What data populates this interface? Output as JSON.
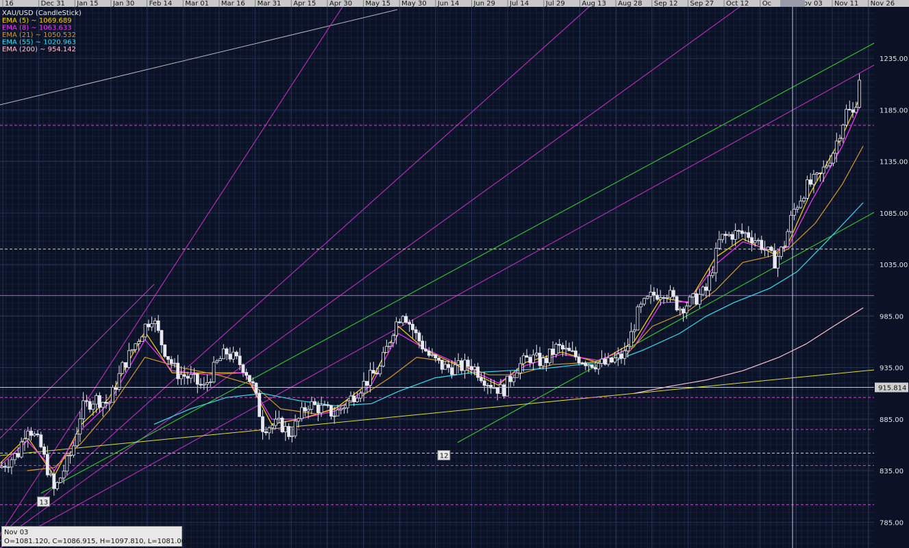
{
  "chart_data": {
    "type": "candlestick",
    "title": "XAU/USD (CandleStick)",
    "x_axis_labels": [
      "16",
      "Dec 31",
      "Jan 15",
      "Jan 30",
      "Feb 14",
      "Mar 01",
      "Mar 16",
      "Mar 31",
      "Apr 15",
      "Apr 30",
      "May 15",
      "May 30",
      "Jun 14",
      "Jun 29",
      "Jul 14",
      "Jul 29",
      "Aug 13",
      "Aug 28",
      "Sep 12",
      "Sep 27",
      "Oct 12",
      "Oc",
      "Nov 03",
      "Nov 11",
      "Nov 26"
    ],
    "y_axis_labels": [
      "1235.00",
      "1185.00",
      "1135.00",
      "1085.00",
      "1035.00",
      "985.00",
      "935.00",
      "915.814",
      "885.00",
      "835.00",
      "785.00"
    ],
    "ylim": [
      760,
      1285
    ],
    "current_price": "915.814",
    "legend": [
      {
        "label": "EMA (5) ~ 1069.689",
        "color": "#ffd200"
      },
      {
        "label": "EMA (8) ~ 1063.633",
        "color": "#ff33ff"
      },
      {
        "label": "EMA (21) ~ 1050.532",
        "color": "#d79a2b"
      },
      {
        "label": "EMA (55) ~ 1020.963",
        "color": "#35e0f0"
      },
      {
        "label": "EMA (200) ~ 954.142",
        "color": "#ffc2d0"
      }
    ],
    "horizontal_levels": [
      {
        "value": 1170,
        "color": "#d24ad2",
        "style": "dashed"
      },
      {
        "value": 1050,
        "color": "#e0e030",
        "style": "dashed"
      },
      {
        "value": 1005,
        "color": "#d24ad2",
        "style": "solid"
      },
      {
        "value": 906,
        "color": "#d24ad2",
        "style": "dashed"
      },
      {
        "value": 875,
        "color": "#d24ad2",
        "style": "dashed"
      },
      {
        "value": 852,
        "color": "#e0e030",
        "style": "dashed"
      },
      {
        "value": 840,
        "color": "#d24ad2",
        "style": "dashed"
      },
      {
        "value": 802,
        "color": "#d24ad2",
        "style": "dashed"
      }
    ],
    "markers": [
      {
        "label": "13",
        "x": 4.8,
        "value": 805
      },
      {
        "label": "12",
        "x": 49,
        "value": 850
      }
    ],
    "crosshair": {
      "x": 87.5,
      "price": 915.814
    },
    "price_path": [
      [
        0,
        838
      ],
      [
        2,
        852
      ],
      [
        3,
        880
      ],
      [
        4.5,
        858
      ],
      [
        6,
        815
      ],
      [
        7,
        835
      ],
      [
        8,
        855
      ],
      [
        9,
        895
      ],
      [
        10.5,
        905
      ],
      [
        12,
        900
      ],
      [
        13.5,
        935
      ],
      [
        16,
        975
      ],
      [
        16.8,
        985
      ],
      [
        18,
        955
      ],
      [
        19.5,
        930
      ],
      [
        21,
        925
      ],
      [
        22.5,
        915
      ],
      [
        24,
        940
      ],
      [
        25,
        950
      ],
      [
        27,
        935
      ],
      [
        28,
        915
      ],
      [
        29,
        878
      ],
      [
        31,
        880
      ],
      [
        32,
        870
      ],
      [
        34,
        900
      ],
      [
        35.5,
        895
      ],
      [
        37,
        890
      ],
      [
        38.5,
        903
      ],
      [
        40,
        918
      ],
      [
        42,
        935
      ],
      [
        43.5,
        975
      ],
      [
        44.5,
        990
      ],
      [
        46,
        965
      ],
      [
        47.5,
        945
      ],
      [
        49,
        935
      ],
      [
        50.5,
        935
      ],
      [
        52,
        938
      ],
      [
        54,
        920
      ],
      [
        55.5,
        912
      ],
      [
        57,
        935
      ],
      [
        58.5,
        945
      ],
      [
        60,
        940
      ],
      [
        61.5,
        955
      ],
      [
        63,
        948
      ],
      [
        65,
        940
      ],
      [
        67,
        938
      ],
      [
        69,
        948
      ],
      [
        70.5,
        990
      ],
      [
        72,
        1005
      ],
      [
        73.5,
        1010
      ],
      [
        75,
        993
      ],
      [
        76.5,
        1000
      ],
      [
        78,
        1010
      ],
      [
        79.5,
        1060
      ],
      [
        81,
        1065
      ],
      [
        82.5,
        1065
      ],
      [
        84,
        1055
      ],
      [
        85.5,
        1038
      ],
      [
        86.5,
        1052
      ],
      [
        87.5,
        1085
      ],
      [
        89,
        1110
      ],
      [
        90.5,
        1120
      ],
      [
        92,
        1145
      ],
      [
        93.5,
        1185
      ],
      [
        94.3,
        1180
      ],
      [
        95,
        1225
      ]
    ],
    "ema_paths": {
      "ema5": [
        [
          0,
          842
        ],
        [
          3,
          868
        ],
        [
          6,
          830
        ],
        [
          9,
          880
        ],
        [
          12,
          905
        ],
        [
          16,
          970
        ],
        [
          19,
          930
        ],
        [
          23,
          930
        ],
        [
          27,
          930
        ],
        [
          30,
          880
        ],
        [
          33,
          885
        ],
        [
          37,
          895
        ],
        [
          41,
          922
        ],
        [
          44,
          975
        ],
        [
          47,
          952
        ],
        [
          51,
          935
        ],
        [
          55,
          918
        ],
        [
          58,
          940
        ],
        [
          62,
          950
        ],
        [
          66,
          940
        ],
        [
          70,
          960
        ],
        [
          73,
          1003
        ],
        [
          76,
          998
        ],
        [
          79,
          1042
        ],
        [
          82,
          1060
        ],
        [
          85.5,
          1045
        ],
        [
          87,
          1055
        ],
        [
          89.5,
          1105
        ],
        [
          93,
          1160
        ],
        [
          95,
          1198
        ]
      ],
      "ema8": [
        [
          0,
          840
        ],
        [
          3,
          864
        ],
        [
          6,
          835
        ],
        [
          9,
          875
        ],
        [
          12,
          900
        ],
        [
          16,
          962
        ],
        [
          19,
          932
        ],
        [
          23,
          928
        ],
        [
          27,
          930
        ],
        [
          30,
          885
        ],
        [
          33,
          885
        ],
        [
          37,
          893
        ],
        [
          41,
          918
        ],
        [
          44,
          968
        ],
        [
          47,
          953
        ],
        [
          51,
          937
        ],
        [
          55,
          920
        ],
        [
          58,
          937
        ],
        [
          62,
          948
        ],
        [
          66,
          942
        ],
        [
          70,
          955
        ],
        [
          73,
          998
        ],
        [
          76,
          999
        ],
        [
          79,
          1035
        ],
        [
          82,
          1057
        ],
        [
          85.5,
          1048
        ],
        [
          87,
          1052
        ],
        [
          89.5,
          1095
        ],
        [
          93,
          1150
        ],
        [
          95,
          1190
        ]
      ],
      "ema21": [
        [
          3,
          835
        ],
        [
          6,
          838
        ],
        [
          9,
          862
        ],
        [
          12,
          893
        ],
        [
          16,
          945
        ],
        [
          20,
          935
        ],
        [
          24,
          928
        ],
        [
          28,
          918
        ],
        [
          31,
          895
        ],
        [
          35,
          890
        ],
        [
          39,
          902
        ],
        [
          43,
          925
        ],
        [
          46,
          945
        ],
        [
          50,
          940
        ],
        [
          54,
          928
        ],
        [
          57,
          928
        ],
        [
          61,
          938
        ],
        [
          65,
          940
        ],
        [
          69,
          946
        ],
        [
          72,
          975
        ],
        [
          76,
          990
        ],
        [
          79,
          1010
        ],
        [
          82,
          1037
        ],
        [
          85,
          1043
        ],
        [
          87,
          1050
        ],
        [
          90,
          1075
        ],
        [
          93,
          1113
        ],
        [
          95.3,
          1150
        ]
      ],
      "ema55": [
        [
          17,
          880
        ],
        [
          21,
          895
        ],
        [
          25,
          906
        ],
        [
          29,
          910
        ],
        [
          33,
          903
        ],
        [
          37,
          898
        ],
        [
          41,
          900
        ],
        [
          44,
          912
        ],
        [
          48,
          925
        ],
        [
          52,
          930
        ],
        [
          56,
          932
        ],
        [
          60,
          934
        ],
        [
          64,
          938
        ],
        [
          68,
          942
        ],
        [
          71,
          952
        ],
        [
          75,
          968
        ],
        [
          78,
          985
        ],
        [
          81,
          998
        ],
        [
          85,
          1012
        ],
        [
          88,
          1028
        ],
        [
          91,
          1055
        ],
        [
          95.3,
          1095
        ]
      ],
      "ema200": [
        [
          70,
          910
        ],
        [
          74,
          917
        ],
        [
          78,
          923
        ],
        [
          82,
          932
        ],
        [
          86,
          945
        ],
        [
          89,
          958
        ],
        [
          92,
          975
        ],
        [
          95.3,
          993
        ]
      ]
    }
  }
}
